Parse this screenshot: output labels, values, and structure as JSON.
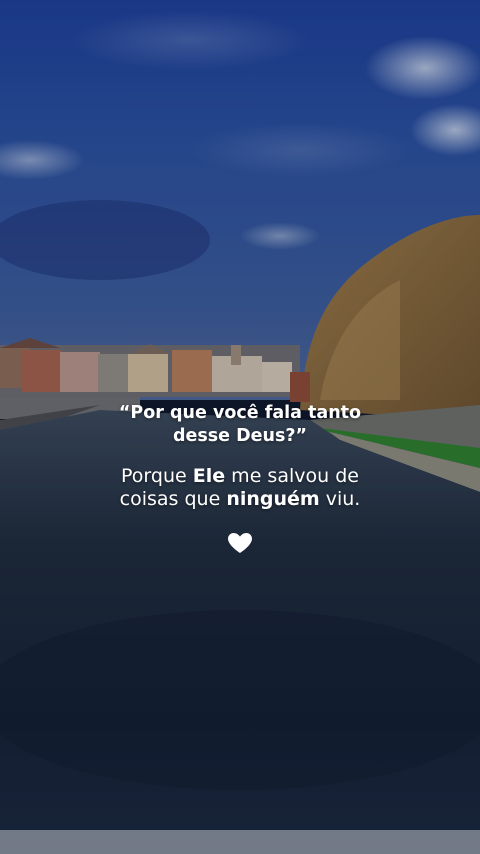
{
  "quote": {
    "line1": "“Por que você fala tanto",
    "line2": "desse Deus?”"
  },
  "answer": {
    "l1_a": "Porque ",
    "l1_b": "Ele",
    "l1_c": " me salvou de",
    "l2_a": "coisas que ",
    "l2_b": "ninguém",
    "l2_c": " viu."
  },
  "icons": {
    "heart": "heart-icon"
  },
  "colors": {
    "sky": "#2a4f9e",
    "river": "#1e2a3c",
    "trees": "#8a6a3e",
    "grass": "#2f7d32",
    "text": "#ffffff"
  }
}
